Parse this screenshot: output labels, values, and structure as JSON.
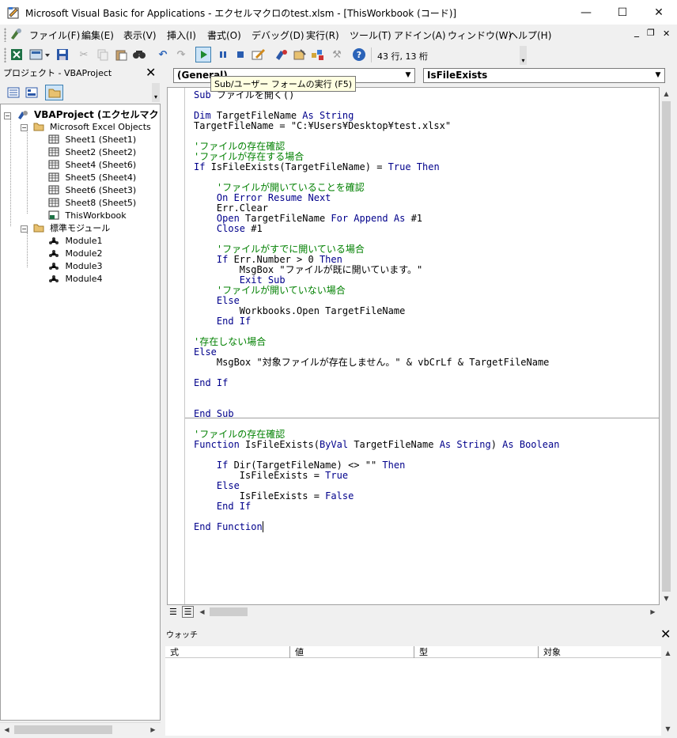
{
  "window": {
    "title": "Microsoft Visual Basic for Applications - エクセルマクロのtest.xlsm - [ThisWorkbook (コード)]",
    "minimize": "—",
    "maximize": "☐",
    "close": "✕"
  },
  "menu": {
    "items": [
      "ファイル(F)",
      "編集(E)",
      "表示(V)",
      "挿入(I)",
      "書式(O)",
      "デバッグ(D)",
      "実行(R)",
      "ツール(T)",
      "アドイン(A)",
      "ウィンドウ(W)",
      "ヘルプ(H)"
    ],
    "mdi_min": "_",
    "mdi_restore": "❐",
    "mdi_close": "✕"
  },
  "toolbar": {
    "cursor_position": "43 行, 13 桁",
    "icons": [
      "excel-icon",
      "insert-module-icon",
      "save-icon",
      "cut-icon",
      "copy-icon",
      "paste-icon",
      "find-icon",
      "undo-icon",
      "redo-icon",
      "run-icon",
      "break-icon",
      "reset-icon",
      "design-mode-icon",
      "project-explorer-icon",
      "properties-icon",
      "object-browser-icon",
      "toolbox-icon",
      "help-icon"
    ]
  },
  "project": {
    "title": "プロジェクト - VBAProject",
    "close": "✕",
    "root": "VBAProject (エクセルマクロの",
    "folders": {
      "excel_objects": "Microsoft Excel Objects",
      "modules": "標準モジュール"
    },
    "sheets": [
      "Sheet1 (Sheet1)",
      "Sheet2 (Sheet2)",
      "Sheet4 (Sheet6)",
      "Sheet5 (Sheet4)",
      "Sheet6 (Sheet3)",
      "Sheet8 (Sheet5)",
      "ThisWorkbook"
    ],
    "modules": [
      "Module1",
      "Module2",
      "Module3",
      "Module4"
    ]
  },
  "code": {
    "object_combo": "(General)",
    "procedure_combo": "IsFileExists",
    "tooltip": "Sub/ユーザー フォームの実行 (F5)"
  },
  "watch": {
    "title": "ウォッチ",
    "close": "✕",
    "columns": [
      "式",
      "値",
      "型",
      "対象"
    ]
  },
  "colors": {
    "keyword": "#00008b",
    "comment": "#008000",
    "tooltip_bg": "#ffffe1"
  }
}
